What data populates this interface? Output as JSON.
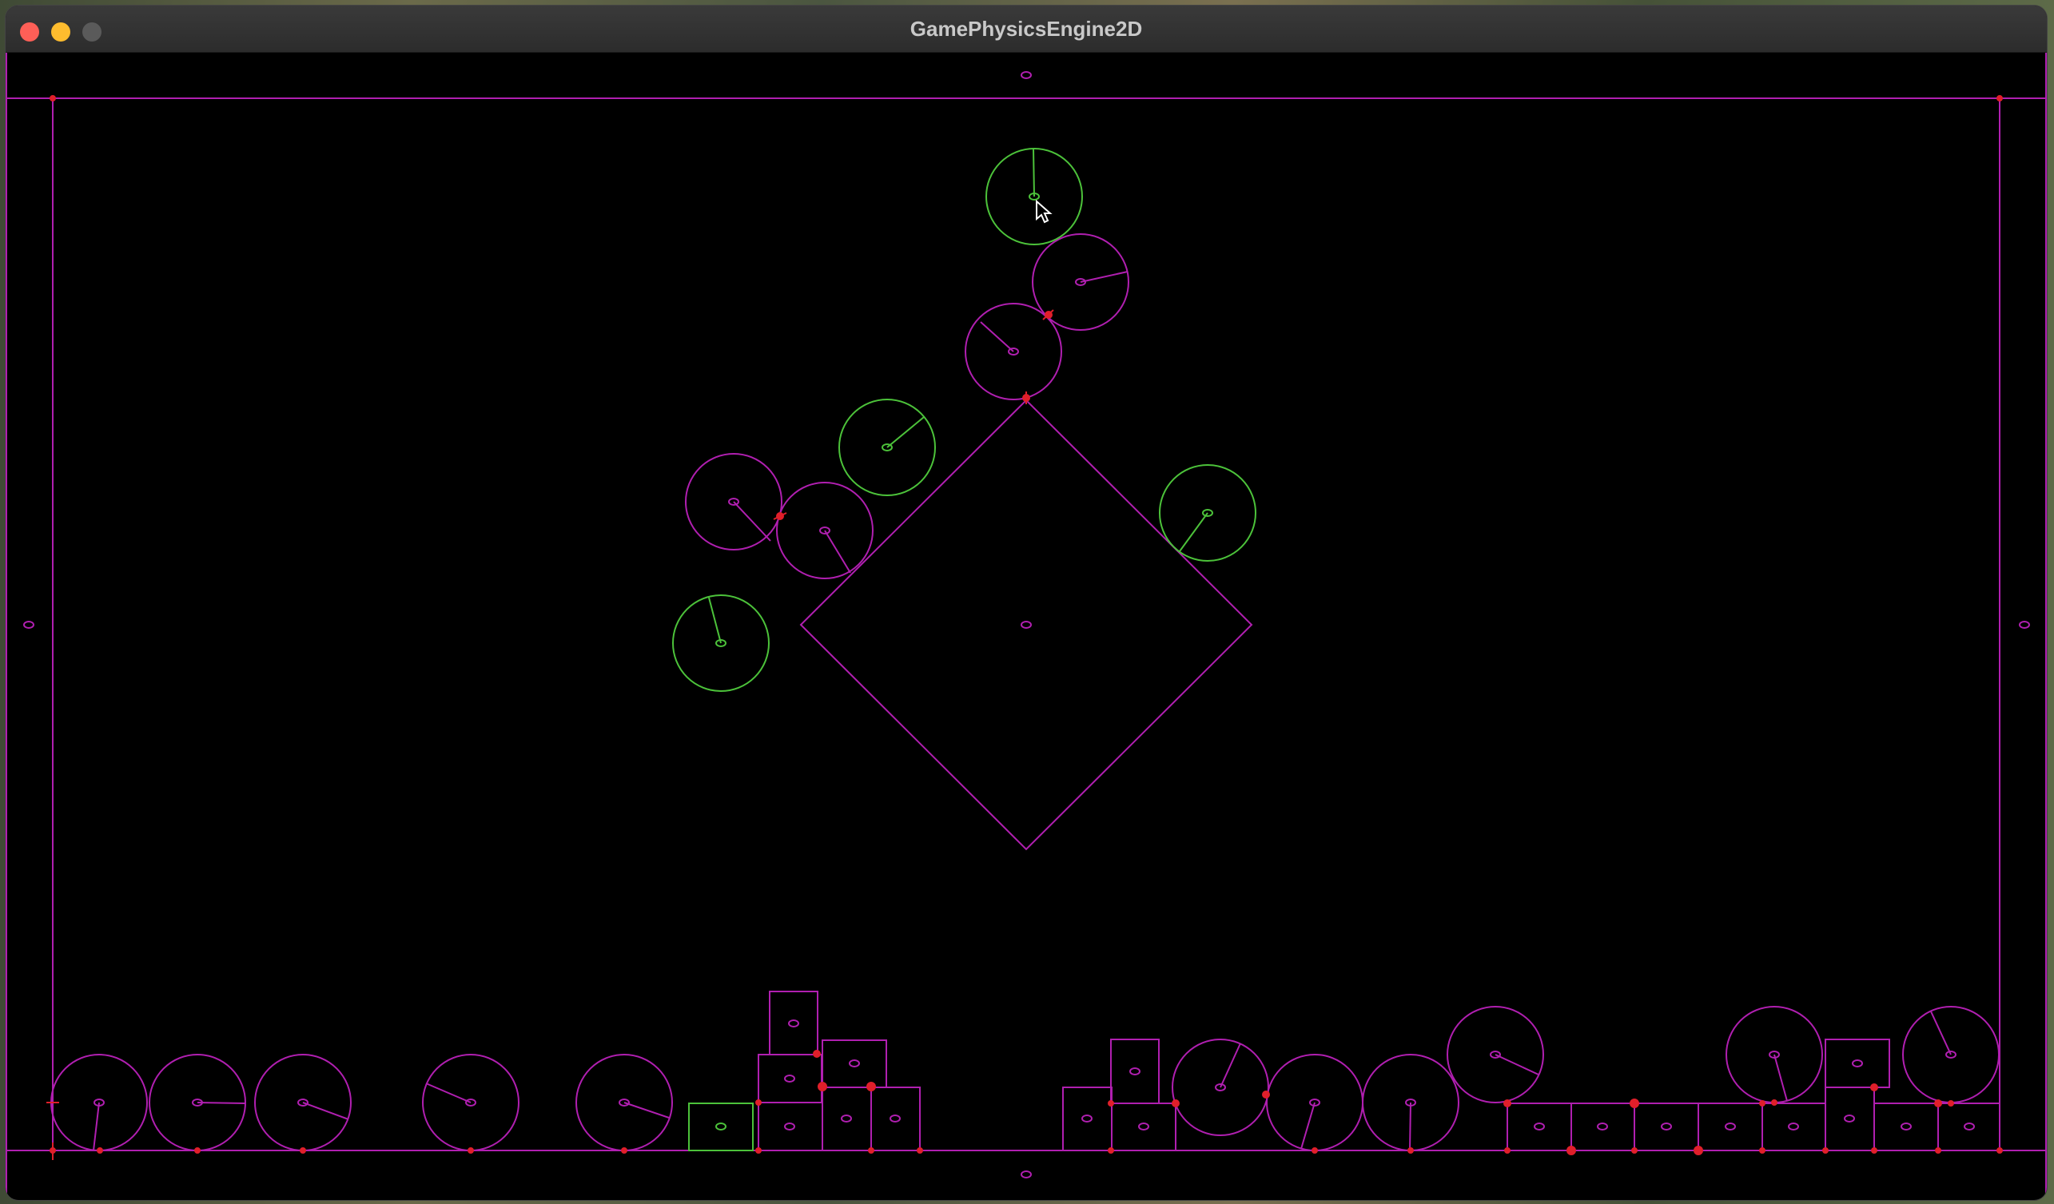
{
  "window": {
    "title": "GamePhysicsEngine2D"
  },
  "colors": {
    "background": "#000000",
    "static_body": "#b01fb0",
    "awake_body": "#4cc23a",
    "contact_point": "#e01f2a"
  },
  "scene_description_icons": {
    "cursor": "arrow-pointer-icon"
  }
}
